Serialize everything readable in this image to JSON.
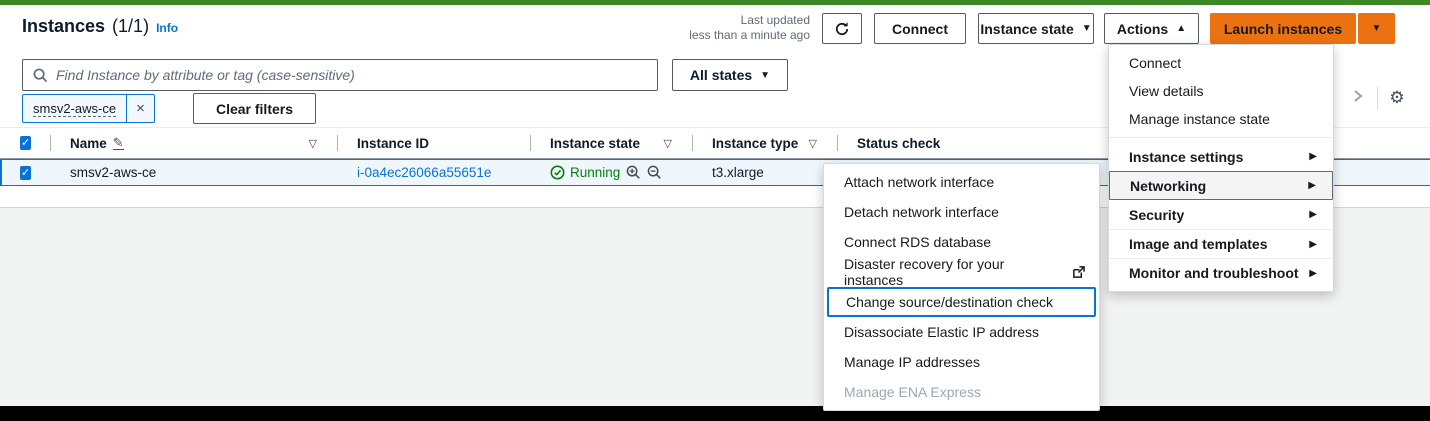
{
  "page": {
    "title": "Instances",
    "count": "(1/1)",
    "info_label": "Info",
    "last_updated_line1": "Last updated",
    "last_updated_line2": "less than a minute ago"
  },
  "toolbar": {
    "connect_label": "Connect",
    "instance_state_label": "Instance state",
    "actions_label": "Actions",
    "launch_label": "Launch instances"
  },
  "filters": {
    "search_placeholder": "Find Instance by attribute or tag (case-sensitive)",
    "all_states_label": "All states",
    "token_label": "smsv2-aws-ce",
    "clear_filters_label": "Clear filters"
  },
  "table": {
    "columns": {
      "name": "Name",
      "instance_id": "Instance ID",
      "instance_state": "Instance state",
      "instance_type": "Instance type",
      "status_check": "Status check"
    },
    "rows": [
      {
        "name": "smsv2-aws-ce",
        "instance_id": "i-0a4ec26066a55651e",
        "state": "Running",
        "type": "t3.xlarge"
      }
    ]
  },
  "actions_menu": {
    "items": [
      {
        "label": "Connect"
      },
      {
        "label": "View details"
      },
      {
        "label": "Manage instance state"
      },
      {
        "label": "Instance settings",
        "submenu": true
      },
      {
        "label": "Networking",
        "submenu": true,
        "highlighted": true
      },
      {
        "label": "Security",
        "submenu": true
      },
      {
        "label": "Image and templates",
        "submenu": true
      },
      {
        "label": "Monitor and troubleshoot",
        "submenu": true
      }
    ]
  },
  "networking_submenu": {
    "items": [
      {
        "label": "Attach network interface"
      },
      {
        "label": "Detach network interface"
      },
      {
        "label": "Connect RDS database"
      },
      {
        "label": "Disaster recovery for your instances",
        "external": true
      },
      {
        "label": "Change source/destination check",
        "highlighted": true
      },
      {
        "label": "Disassociate Elastic IP address"
      },
      {
        "label": "Manage IP addresses"
      },
      {
        "label": "Manage ENA Express",
        "disabled": true
      }
    ]
  },
  "icons": {
    "caret_down": "▼",
    "caret_up": "▲",
    "submenu_arrow": "▶",
    "sort": "▽",
    "close": "×",
    "check": "✓",
    "gear": "⚙",
    "chevron_right": "›",
    "edit": "✎"
  },
  "colors": {
    "accent_blue": "#0972d3",
    "primary_orange": "#ec7211",
    "status_green": "#037f0c",
    "top_bar_green": "#3f8624",
    "page_gray": "#f2f3f3"
  }
}
